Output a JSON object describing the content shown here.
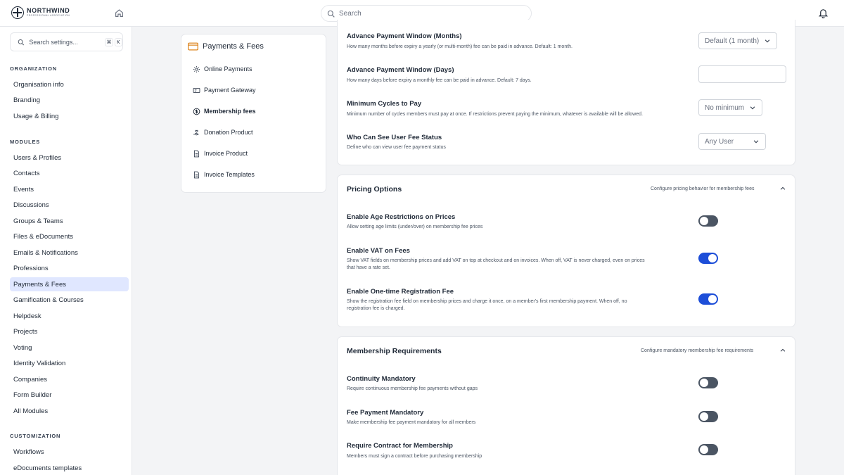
{
  "brand": {
    "name": "NORTHWIND",
    "tagline": "PROFESSIONAL ASSOCIATION"
  },
  "topbar": {
    "search_placeholder": "Search"
  },
  "sidebar": {
    "search_placeholder": "Search settings...",
    "shortcut_keys": [
      "⌘",
      "K"
    ],
    "sections": [
      {
        "title": "ORGANIZATION",
        "items": [
          "Organisation info",
          "Branding",
          "Usage & Billing"
        ]
      },
      {
        "title": "MODULES",
        "items": [
          "Users & Profiles",
          "Contacts",
          "Events",
          "Discussions",
          "Groups & Teams",
          "Files & eDocuments",
          "Emails & Notifications",
          "Professions",
          "Payments & Fees",
          "Gamification & Courses",
          "Helpdesk",
          "Projects",
          "Voting",
          "Identity Validation",
          "Companies",
          "Form Builder",
          "All Modules"
        ]
      },
      {
        "title": "CUSTOMIZATION",
        "items": [
          "Workflows",
          "eDocuments templates"
        ]
      }
    ],
    "active_item": "Payments & Fees"
  },
  "subnav": {
    "title": "Payments & Fees",
    "items": [
      {
        "label": "Online Payments",
        "icon": "gear-icon"
      },
      {
        "label": "Payment Gateway",
        "icon": "card-icon"
      },
      {
        "label": "Membership fees",
        "icon": "dollar-icon",
        "active": true
      },
      {
        "label": "Donation Product",
        "icon": "hand-heart-icon"
      },
      {
        "label": "Invoice Product",
        "icon": "document-icon"
      },
      {
        "label": "Invoice Templates",
        "icon": "document-icon"
      }
    ]
  },
  "settings": {
    "advance_months": {
      "title": "Advance Payment Window (Months)",
      "desc": "How many months before expiry a yearly (or multi-month) fee can be paid in advance. Default: 1 month.",
      "value": "Default (1 month)"
    },
    "advance_days": {
      "title": "Advance Payment Window (Days)",
      "desc": "How many days before expiry a monthly fee can be paid in advance. Default: 7 days.",
      "value": ""
    },
    "min_cycles": {
      "title": "Minimum Cycles to Pay",
      "desc": "Minimum number of cycles members must pay at once. If restrictions prevent paying the minimum, whatever is available will be allowed.",
      "value": "No minimum"
    },
    "fee_status": {
      "title": "Who Can See User Fee Status",
      "desc": "Define who can view user fee payment status",
      "value": "Any User"
    }
  },
  "pricing": {
    "title": "Pricing Options",
    "hint": "Configure pricing behavior for membership fees",
    "rows": [
      {
        "title": "Enable Age Restrictions on Prices",
        "desc": "Allow setting age limits (under/over) on membership fee prices",
        "on": false
      },
      {
        "title": "Enable VAT on Fees",
        "desc_lines": [
          "Show VAT fields on membership prices and add VAT on top at checkout and on invoices. When off, VAT is never charged, even on prices",
          "that have a rate set."
        ],
        "on": true
      },
      {
        "title": "Enable One-time Registration Fee",
        "desc_lines": [
          "Show the registration fee field on membership prices and charge it once, on a member's first membership payment. When off, no",
          "registration fee is charged."
        ],
        "on": true
      }
    ]
  },
  "requirements": {
    "title": "Membership Requirements",
    "hint": "Configure mandatory membership fee requirements",
    "rows": [
      {
        "title": "Continuity Mandatory",
        "desc": "Require continuous membership fee payments without gaps",
        "on": false
      },
      {
        "title": "Fee Payment Mandatory",
        "desc": "Make membership fee payment mandatory for all members",
        "on": false
      },
      {
        "title": "Require Contract for Membership",
        "desc": "Members must sign a contract before purchasing membership",
        "on": false
      }
    ]
  }
}
